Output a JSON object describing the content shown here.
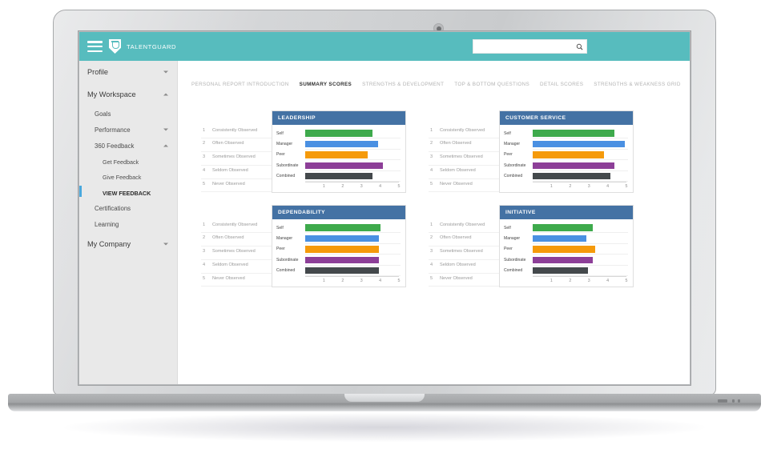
{
  "header": {
    "brand_name": "TALENTGUARD",
    "menu_icon": "hamburger-icon",
    "logo_icon": "talentguard-shield-icon",
    "accent_color": "#57bcbe",
    "search": {
      "value": "",
      "placeholder": "",
      "icon": "search-icon"
    }
  },
  "sidebar": {
    "items": [
      {
        "label": "Profile",
        "level": 0,
        "caret": "down",
        "active": false
      },
      {
        "label": "My Workspace",
        "level": 0,
        "caret": "up",
        "active": false
      },
      {
        "label": "Goals",
        "level": 1,
        "caret": "",
        "active": false
      },
      {
        "label": "Performance",
        "level": 1,
        "caret": "down",
        "active": false
      },
      {
        "label": "360 Feedback",
        "level": 1,
        "caret": "up",
        "active": false
      },
      {
        "label": "Get Feedback",
        "level": 2,
        "caret": "",
        "active": false
      },
      {
        "label": "Give Feedback",
        "level": 2,
        "caret": "",
        "active": false
      },
      {
        "label": "VIEW FEEDBACK",
        "level": 2,
        "caret": "",
        "active": true
      },
      {
        "label": "Certifications",
        "level": 1,
        "caret": "",
        "active": false
      },
      {
        "label": "Learning",
        "level": 1,
        "caret": "",
        "active": false
      },
      {
        "label": "My Company",
        "level": 0,
        "caret": "down",
        "active": false
      }
    ],
    "active_indicator_color": "#49a8dd"
  },
  "tabs": [
    {
      "label": "PERSONAL REPORT INTRODUCTION",
      "active": false
    },
    {
      "label": "SUMMARY SCORES",
      "active": true
    },
    {
      "label": "STRENGTHS & DEVELOPMENT",
      "active": false
    },
    {
      "label": "TOP & BOTTOM QUESTIONS",
      "active": false
    },
    {
      "label": "DETAIL SCORES",
      "active": false
    },
    {
      "label": "STRENGTHS & WEAKNESS GRID",
      "active": false
    }
  ],
  "rating_legend": [
    {
      "num": "1",
      "label": "Consistently Observed"
    },
    {
      "num": "2",
      "label": "Often Observed"
    },
    {
      "num": "3",
      "label": "Sometimes Observed"
    },
    {
      "num": "4",
      "label": "Seldom Observed"
    },
    {
      "num": "5",
      "label": "Never Observed"
    }
  ],
  "panel_header_color": "#4472a4",
  "rater_colors": {
    "Self": "#3eaa4c",
    "Manager": "#4a90e2",
    "Peer": "#f59a0b",
    "Subordinate": "#8d3f98",
    "Combined": "#44494c"
  },
  "chart_data": [
    {
      "type": "bar",
      "title": "LEADERSHIP",
      "orientation": "horizontal",
      "categories": [
        "Self",
        "Manager",
        "Peer",
        "Subordinate",
        "Combined"
      ],
      "values": [
        3.6,
        3.9,
        3.35,
        4.15,
        3.6
      ],
      "xlabel": "",
      "ylabel": "",
      "xlim": [
        0,
        5
      ],
      "xticks": [
        "1",
        "2",
        "3",
        "4",
        "5"
      ],
      "grid": false,
      "legend": "none"
    },
    {
      "type": "bar",
      "title": "CUSTOMER SERVICE",
      "orientation": "horizontal",
      "categories": [
        "Self",
        "Manager",
        "Peer",
        "Subordinate",
        "Combined"
      ],
      "values": [
        4.35,
        4.9,
        3.8,
        4.35,
        4.15
      ],
      "xlabel": "",
      "ylabel": "",
      "xlim": [
        0,
        5
      ],
      "xticks": [
        "1",
        "2",
        "3",
        "4",
        "5"
      ],
      "grid": false,
      "legend": "none"
    },
    {
      "type": "bar",
      "title": "DEPENDABILITY",
      "orientation": "horizontal",
      "categories": [
        "Self",
        "Manager",
        "Peer",
        "Subordinate",
        "Combined"
      ],
      "values": [
        4.0,
        3.95,
        3.95,
        3.95,
        3.95
      ],
      "xlabel": "",
      "ylabel": "",
      "xlim": [
        0,
        5
      ],
      "xticks": [
        "1",
        "2",
        "3",
        "4",
        "5"
      ],
      "grid": false,
      "legend": "none"
    },
    {
      "type": "bar",
      "title": "INITIATIVE",
      "orientation": "horizontal",
      "categories": [
        "Self",
        "Manager",
        "Peer",
        "Subordinate",
        "Combined"
      ],
      "values": [
        3.2,
        2.85,
        3.35,
        3.2,
        2.95
      ],
      "xlabel": "",
      "ylabel": "",
      "xlim": [
        0,
        5
      ],
      "xticks": [
        "1",
        "2",
        "3",
        "4",
        "5"
      ],
      "grid": false,
      "legend": "none"
    }
  ]
}
